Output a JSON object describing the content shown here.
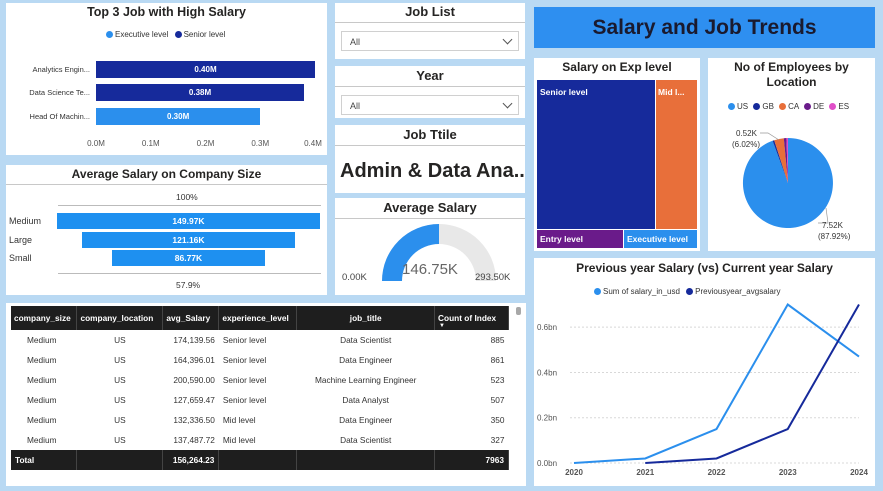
{
  "top_jobs": {
    "title": "Top 3 Job with High Salary",
    "legend": [
      {
        "label": "Executive level",
        "color": "#2b8fed"
      },
      {
        "label": "Senior level",
        "color": "#162a9b"
      }
    ],
    "axis_ticks": [
      "0.0M",
      "0.1M",
      "0.2M",
      "0.3M",
      "0.4M"
    ],
    "bars": [
      {
        "label": "Analytics Engin...",
        "value": 0.4,
        "value_label": "0.40M",
        "color": "#162a9b"
      },
      {
        "label": "Data Science Te...",
        "value": 0.38,
        "value_label": "0.38M",
        "color": "#162a9b"
      },
      {
        "label": "Head Of Machin...",
        "value": 0.3,
        "value_label": "0.30M",
        "color": "#2b8fed"
      }
    ]
  },
  "avg_company_size": {
    "title": "Average Salary on Company Size",
    "top_pct": "100%",
    "bottom_pct": "57.9%",
    "rows": [
      {
        "label": "Medium",
        "value": 149.97,
        "value_label": "149.97K"
      },
      {
        "label": "Large",
        "value": 121.16,
        "value_label": "121.16K"
      },
      {
        "label": "Small",
        "value": 86.77,
        "value_label": "86.77K"
      }
    ]
  },
  "slicers": {
    "job_list": {
      "title": "Job List",
      "value": "All"
    },
    "year": {
      "title": "Year",
      "value": "All"
    }
  },
  "job_title_card": {
    "title": "Job Ttile",
    "value": "Admin & Data Ana..."
  },
  "avg_salary_gauge": {
    "title": "Average Salary",
    "value": 146.75,
    "value_label": "146.75K",
    "min_label": "0.00K",
    "max": 293.5,
    "max_label": "293.50K"
  },
  "header": {
    "title": "Salary and Job Trends"
  },
  "exp_treemap": {
    "title": "Salary on Exp level",
    "tiles": [
      {
        "label": "Senior level",
        "color": "#162a9b"
      },
      {
        "label": "Mid l...",
        "color": "#e86f3a"
      },
      {
        "label": "Entry level",
        "color": "#6a1b8a"
      },
      {
        "label": "Executive level",
        "color": "#2b8fed"
      }
    ]
  },
  "location_pie": {
    "title": "No of Employees by Location",
    "legend": [
      {
        "label": "US",
        "color": "#2b8fed"
      },
      {
        "label": "GB",
        "color": "#162a9b"
      },
      {
        "label": "CA",
        "color": "#e86f3a"
      },
      {
        "label": "DE",
        "color": "#6a1b8a"
      },
      {
        "label": "ES",
        "color": "#e04fc8"
      }
    ],
    "label_small": [
      "0.52K",
      "(6.02%)"
    ],
    "label_large": [
      "7.52K",
      "(87.92%)"
    ]
  },
  "table": {
    "columns": [
      "company_size",
      "company_location",
      "avg_Salary",
      "experience_level",
      "job_title",
      "Count of Index"
    ],
    "rows": [
      [
        "Medium",
        "US",
        "174,139.56",
        "Senior level",
        "Data Scientist",
        "885"
      ],
      [
        "Medium",
        "US",
        "164,396.01",
        "Senior level",
        "Data Engineer",
        "861"
      ],
      [
        "Medium",
        "US",
        "200,590.00",
        "Senior level",
        "Machine Learning Engineer",
        "523"
      ],
      [
        "Medium",
        "US",
        "127,659.47",
        "Senior level",
        "Data Analyst",
        "507"
      ],
      [
        "Medium",
        "US",
        "132,336.50",
        "Mid level",
        "Data Engineer",
        "350"
      ],
      [
        "Medium",
        "US",
        "137,487.72",
        "Mid level",
        "Data Scientist",
        "327"
      ]
    ],
    "total": [
      "Total",
      "",
      "156,264.23",
      "",
      "",
      "7963"
    ]
  },
  "chart_data": {
    "type": "line",
    "title": "Previous year Salary (vs) Current year Salary",
    "x": [
      "2020",
      "2021",
      "2022",
      "2023",
      "2024"
    ],
    "series": [
      {
        "name": "Sum of salary_in_usd",
        "color": "#2b8fed",
        "values": [
          0.0,
          0.02,
          0.15,
          0.7,
          0.47
        ]
      },
      {
        "name": "Previousyear_avgsalary",
        "color": "#162a9b",
        "values": [
          null,
          0.0,
          0.02,
          0.15,
          0.7
        ]
      }
    ],
    "y_ticks": [
      "0.0bn",
      "0.2bn",
      "0.4bn",
      "0.6bn"
    ],
    "ylim": [
      0,
      0.72
    ]
  }
}
